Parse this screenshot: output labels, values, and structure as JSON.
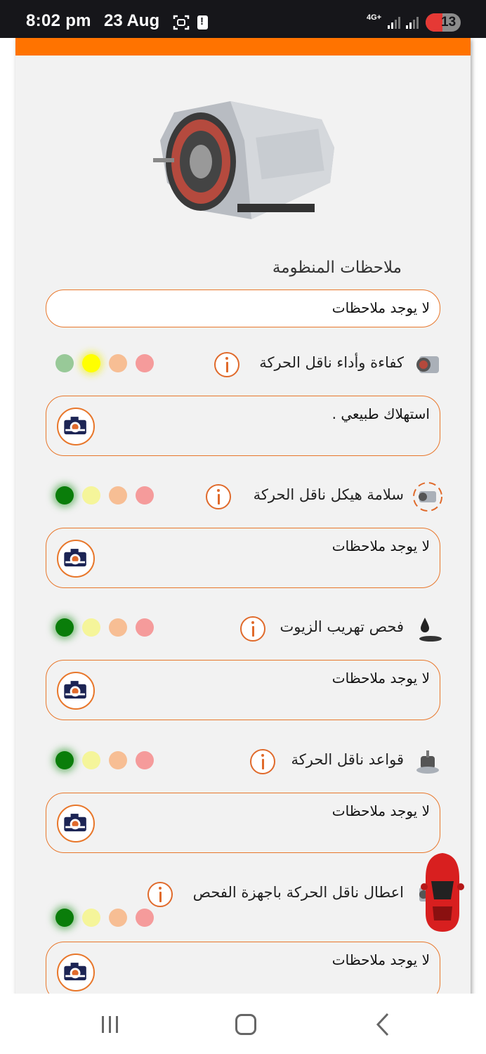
{
  "status_bar": {
    "time": "8:02 pm",
    "date": "23 Aug",
    "network": "4G+",
    "battery": "13"
  },
  "section": {
    "title": "ملاحظات المنظومة",
    "notes_value": "لا يوجد ملاحظات"
  },
  "items": [
    {
      "label": "كفاءة وأداء ناقل الحركة",
      "comment": "استهلاك طبيعي .",
      "icon": "gearbox-icon",
      "selected_level": "yellow"
    },
    {
      "label": "سلامة هيكل ناقل الحركة",
      "comment": "لا يوجد ملاحظات",
      "icon": "gearbox-housing-icon",
      "selected_level": "green"
    },
    {
      "label": "فحص تهريب الزيوت",
      "comment": "لا يوجد ملاحظات",
      "icon": "oil-drop-icon",
      "selected_level": "green"
    },
    {
      "label": "قواعد ناقل الحركة",
      "comment": "لا يوجد ملاحظات",
      "icon": "transmission-mount-icon",
      "selected_level": "green"
    },
    {
      "label": "اعطال ناقل الحركة باجهزة الفحص",
      "comment": "لا يوجد ملاحظات",
      "icon": "diagnostic-device-icon",
      "selected_level": "green"
    }
  ],
  "colors": {
    "accent": "#ff7300",
    "border": "#e8772b",
    "green": "#0a7d0a",
    "yellow": "#ffff00",
    "orange": "#f7be94",
    "red": "#f59b9b"
  }
}
